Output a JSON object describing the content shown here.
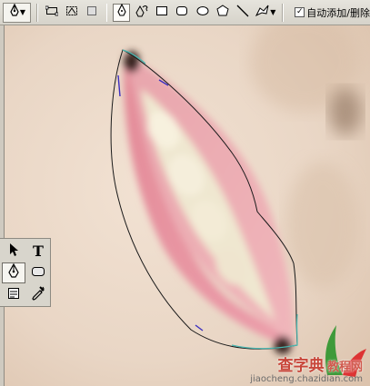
{
  "options_bar": {
    "auto_add_delete_label": "自动添加/删除",
    "auto_add_delete_checked": true,
    "auto_add_checkmark": "✓"
  },
  "tools_panel": {
    "type_tool_glyph": "T"
  },
  "watermark": {
    "brand_text": "查字典",
    "brand_sub": "教程网",
    "site_text": "jiaocheng.chazidian.com"
  },
  "colors": {
    "path_line": "#1a1a1a",
    "path_segment_active": "#49b6b0",
    "anchor_accent": "#3b2fbf"
  },
  "icons": [
    "pen-tool-icon",
    "shape-layers-icon",
    "paths-icon",
    "fill-pixels-icon",
    "pen-icon",
    "freeform-pen-icon",
    "rectangle-icon",
    "rounded-rectangle-icon",
    "ellipse-icon",
    "polygon-icon",
    "line-icon",
    "custom-shape-icon",
    "path-selection-icon",
    "type-icon",
    "shape-tool-icon",
    "notes-icon",
    "eyedropper-icon"
  ]
}
